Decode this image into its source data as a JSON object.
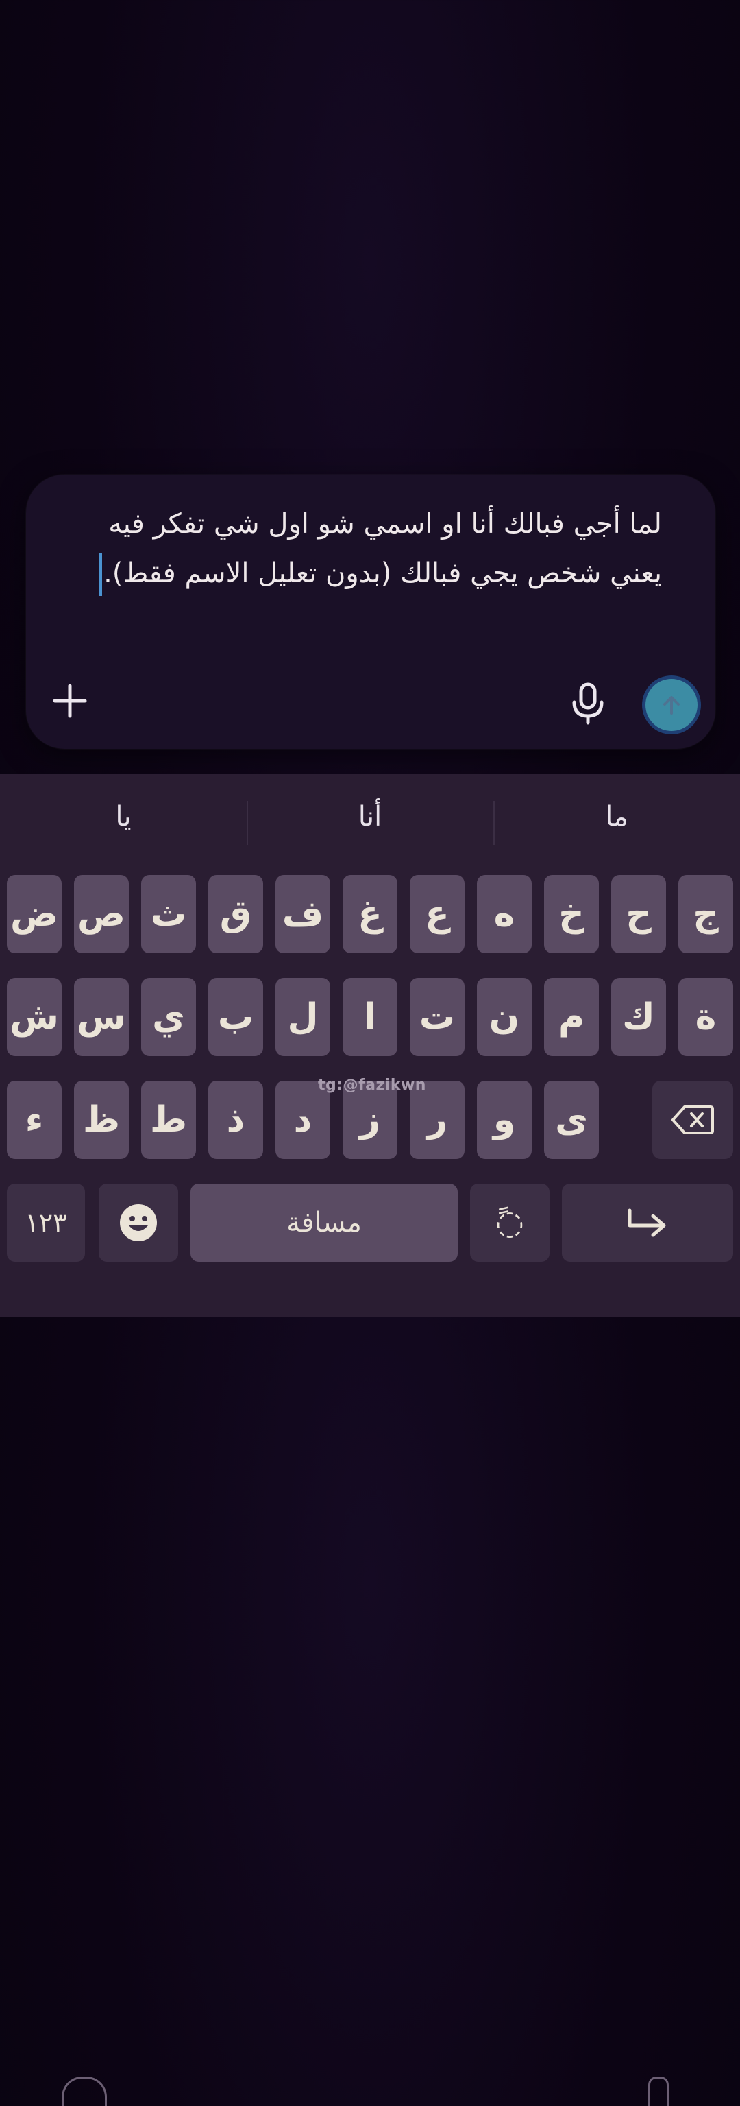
{
  "composer": {
    "text": "لما أجي فبالك أنا او اسمي شو اول شي تفكر فيه يعني شخص يجي فبالك (بدون تعليل الاسم فقط).",
    "icons": {
      "add": "plus-icon",
      "voice": "microphone-icon",
      "send": "arrow-up-icon"
    },
    "send_color": "#3c8ca4"
  },
  "keyboard": {
    "suggestions": [
      "ما",
      "أنا",
      "يا"
    ],
    "row1": [
      "ج",
      "ح",
      "خ",
      "ه",
      "ع",
      "غ",
      "ف",
      "ق",
      "ث",
      "ص",
      "ض"
    ],
    "row2": [
      "ة",
      "ك",
      "م",
      "ن",
      "ت",
      "ا",
      "ل",
      "ب",
      "ي",
      "س",
      "ش"
    ],
    "row3": [
      "ى",
      "و",
      "ر",
      "ز",
      "د",
      "ذ",
      "ط",
      "ظ",
      "ء"
    ],
    "numbers_label": "١٢٣",
    "space_label": "مسافة",
    "tanween_label": "◌ً",
    "icons": {
      "backspace": "backspace-icon",
      "emoji": "emoji-icon",
      "enter": "enter-icon"
    }
  },
  "watermark": "tg:@fazikwn"
}
